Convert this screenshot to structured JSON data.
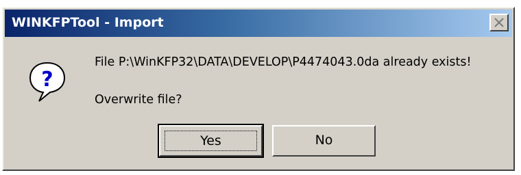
{
  "window": {
    "title": "WINKFPTool - Import",
    "close_icon": "close-icon"
  },
  "dialog": {
    "icon": "question-icon",
    "message": "File P:\\WinKFP32\\DATA\\DEVELOP\\P4474043.0da already exists!",
    "prompt": "Overwrite file?"
  },
  "buttons": {
    "yes_label": "Yes",
    "no_label": "No"
  },
  "colors": {
    "titlebar_start": "#0a246a",
    "titlebar_end": "#a6caf0",
    "dialog_bg": "#d4d0c8",
    "icon_blue": "#0000cc"
  }
}
